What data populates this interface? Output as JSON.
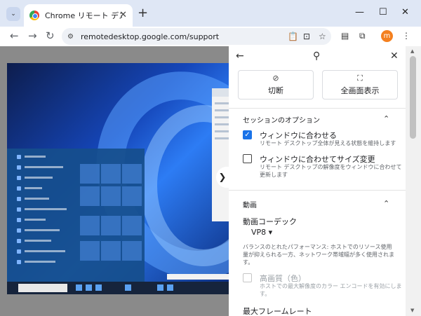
{
  "tab": {
    "title": "Chrome リモート デスクトップ",
    "close": "✕",
    "new_tab": "+"
  },
  "window": {
    "minimize": "—",
    "maximize": "☐",
    "close": "✕"
  },
  "toolbar": {
    "back": "←",
    "forward": "→",
    "reload": "↻",
    "url": "remotedesktop.google.com/support",
    "avatar_letter": "m"
  },
  "icons": {
    "site_info": "⚙",
    "clipboard": "📋",
    "install": "⊡",
    "star": "☆",
    "tab_search": "⌄",
    "reading_mode": "▤",
    "extensions": "⧉",
    "menu": "⋮"
  },
  "panel": {
    "back": "←",
    "pin": "⚲",
    "close": "✕",
    "disconnect_label": "切断",
    "fullscreen_label": "全画面表示",
    "session_options": {
      "title": "セッションのオプション",
      "fit_window": {
        "title": "ウィンドウに合わせる",
        "desc": "リモート デスクトップ全体が見える状態を維持します",
        "checked": true
      },
      "resize_window": {
        "title": "ウィンドウに合わせてサイズ変更",
        "desc": "リモート デスクトップの解像度をウィンドウに合わせて更新します",
        "checked": false
      }
    },
    "video": {
      "title": "動画",
      "codec_label": "動画コーデック",
      "codec_value": "VP8",
      "codec_desc": "バランスのとれたパフォーマンス: ホストでのリソース使用量が抑えられる一方、ネットワーク帯域幅が多く使用されます。",
      "high_quality": {
        "title": "高画質（色）",
        "desc": "ホストでの最大解像度のカラー エンコードを有効にします。",
        "checked": false
      },
      "max_framerate": "最大フレームレート"
    }
  },
  "colors": {
    "accent": "#1a73e8",
    "avatar": "#f4801f",
    "tab_strip": "#dfe7f5"
  }
}
